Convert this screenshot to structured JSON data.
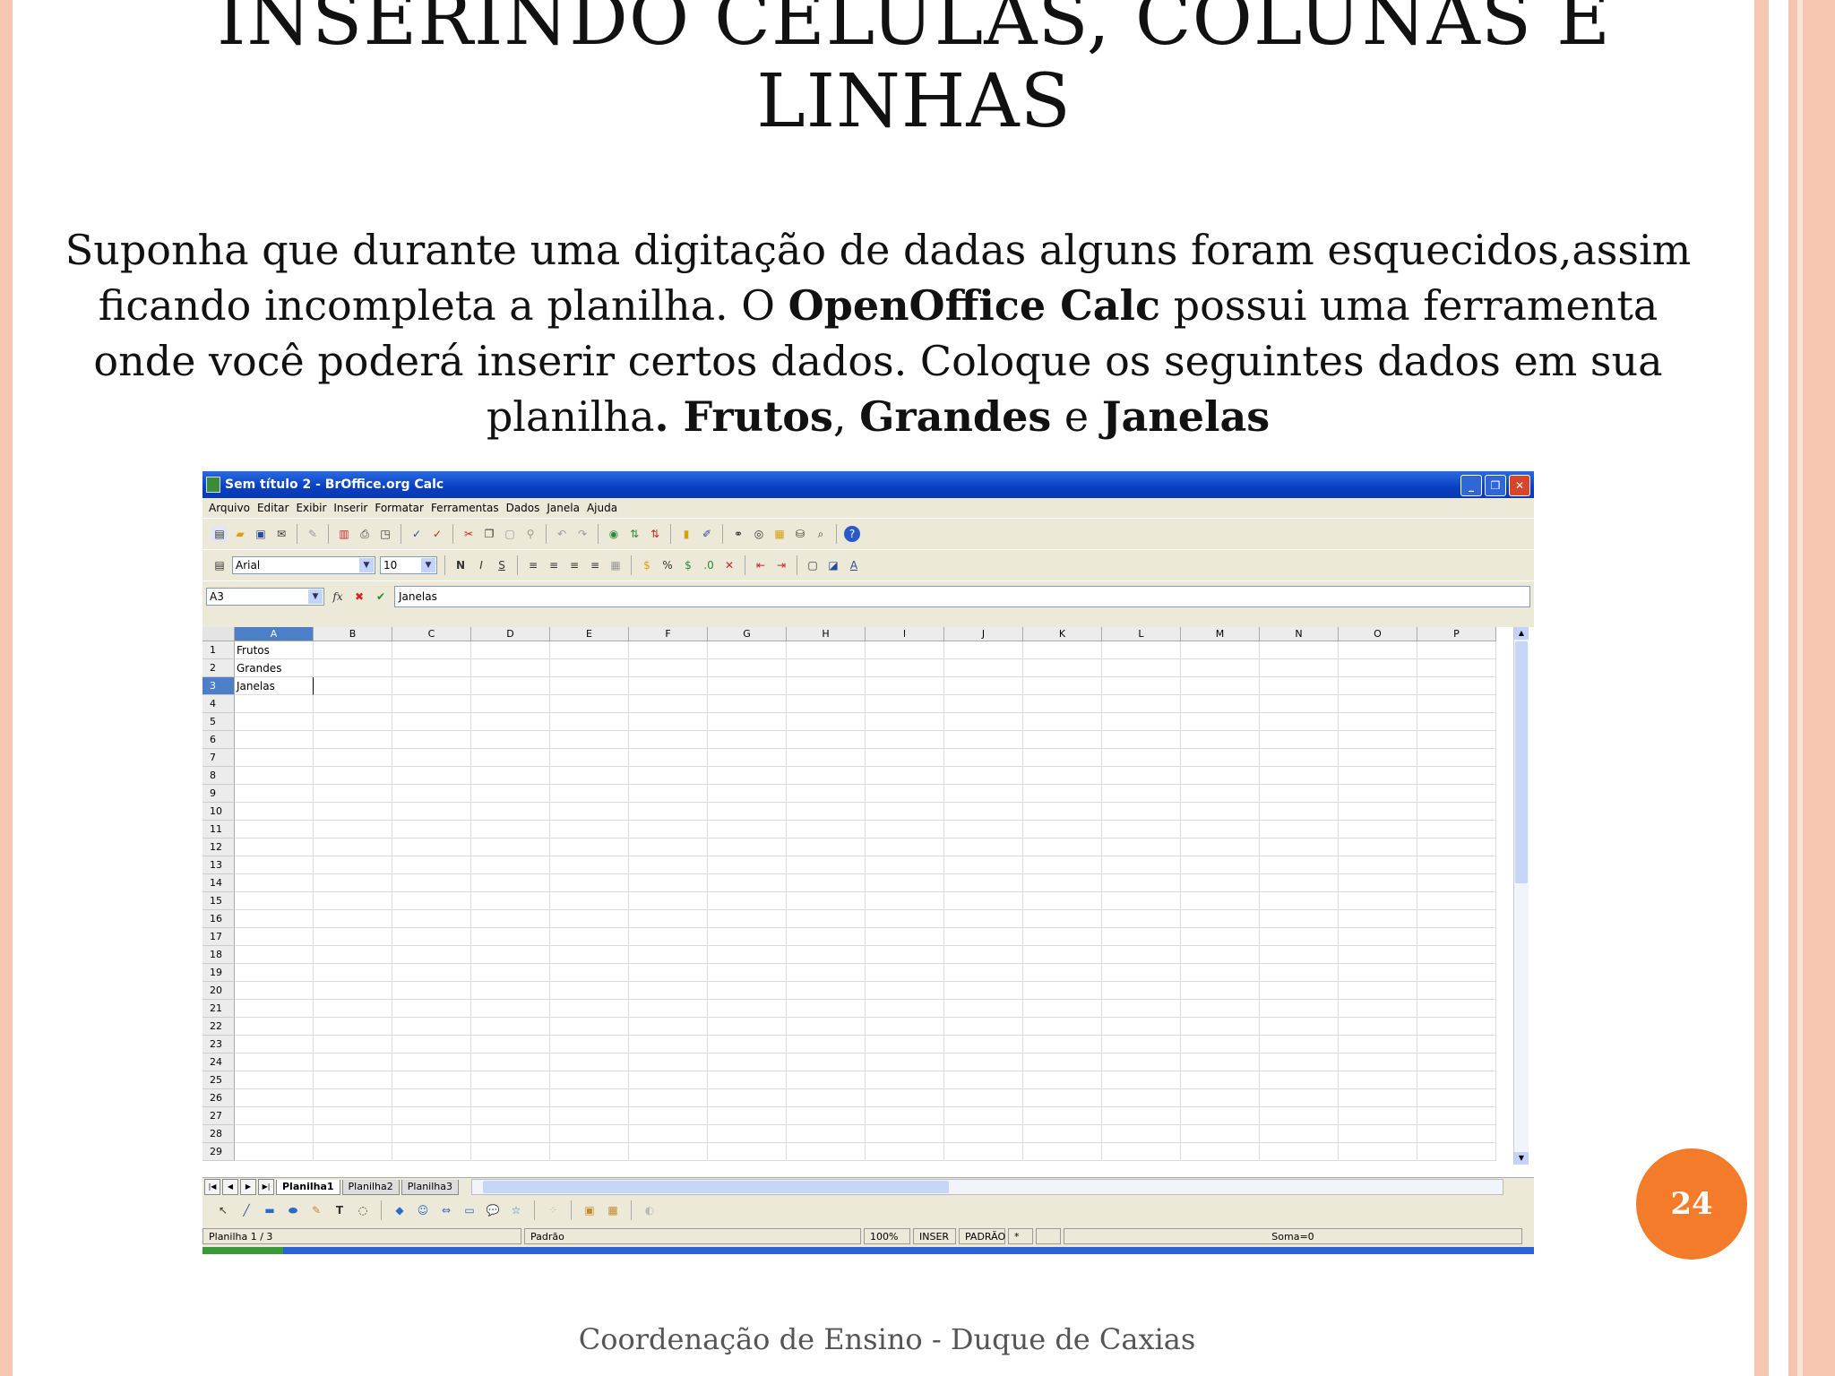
{
  "slide": {
    "title_line1": "INSERINDO CÉLULAS, COLUNAS E",
    "title_line2": "LINHAS",
    "body_part1": "Suponha que durante uma digitação de dadas alguns foram esquecidos,assim ficando incompleta a planilha. O ",
    "body_bold1": "OpenOffice Calc",
    "body_part2": " possui uma ferramenta onde você poderá inserir certos dados. Coloque os seguintes dados em sua planilha",
    "body_bold2": ". Frutos",
    "body_sep1": ", ",
    "body_bold3": "Grandes",
    "body_sep2": " e ",
    "body_bold4": "Janelas",
    "page_number": "24",
    "footer": "Coordenação de Ensino - Duque de Caxias",
    "accent_color": "#f47b2a",
    "stripe_color": "#f7c6b0"
  },
  "calc": {
    "window_title": "Sem título 2 - BrOffice.org Calc",
    "menu": [
      "Arquivo",
      "Editar",
      "Exibir",
      "Inserir",
      "Formatar",
      "Ferramentas",
      "Dados",
      "Janela",
      "Ajuda"
    ],
    "font_name": "Arial",
    "font_size": "10",
    "name_box": "A3",
    "formula_value": "Janelas",
    "fx_label": "fx",
    "columns": [
      "A",
      "B",
      "C",
      "D",
      "E",
      "F",
      "G",
      "H",
      "I",
      "J",
      "K",
      "L",
      "M",
      "N",
      "O",
      "P"
    ],
    "row_count_visible": 29,
    "cells": {
      "A1": "Frutos",
      "A2": "Grandes",
      "A3": "Janelas"
    },
    "sheet_tabs": [
      "Planilha1",
      "Planilha2",
      "Planilha3"
    ],
    "status": {
      "sheet": "Planilha 1 / 3",
      "style": "Padrão",
      "zoom": "100%",
      "mode": "INSER",
      "selection": "PADRÃO",
      "modified": "*",
      "sum": "Soma=0"
    }
  }
}
